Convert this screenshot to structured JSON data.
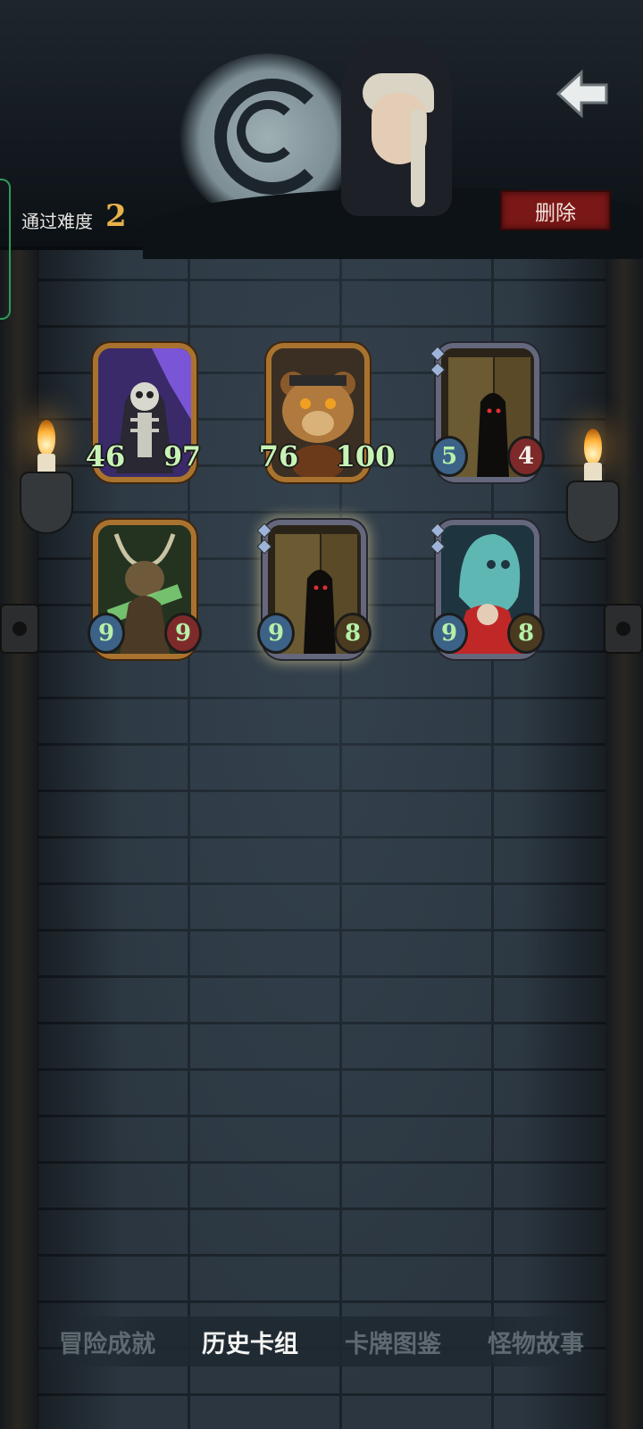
{
  "header": {
    "difficulty_label": "通过难度",
    "difficulty_value": "2",
    "delete_label": "删除"
  },
  "cards": [
    {
      "name": "skeleton-reaper",
      "attack": "46",
      "health": "97",
      "frame": "gold"
    },
    {
      "name": "armored-teddy-bear",
      "attack": "76",
      "health": "100",
      "frame": "gold"
    },
    {
      "name": "shadow-door-lurker",
      "attack": "5",
      "health": "4",
      "frame": "silver"
    },
    {
      "name": "horned-beast-shaman",
      "attack": "9",
      "health": "9",
      "frame": "gold"
    },
    {
      "name": "shadow-door-lurker",
      "attack": "9",
      "health": "8",
      "frame": "silver",
      "selected": true
    },
    {
      "name": "ghost-and-vampire",
      "attack": "9",
      "health": "8",
      "frame": "silver"
    }
  ],
  "tabs": [
    {
      "label": "冒险成就",
      "active": false
    },
    {
      "label": "历史卡组",
      "active": true
    },
    {
      "label": "卡牌图鉴",
      "active": false
    },
    {
      "label": "怪物故事",
      "active": false
    }
  ],
  "colors": {
    "accent": "#e8b24a",
    "delete_bg": "#7a1717",
    "stat_text": "#b5f0a8"
  },
  "icons": {
    "back": "back-arrow-icon"
  }
}
